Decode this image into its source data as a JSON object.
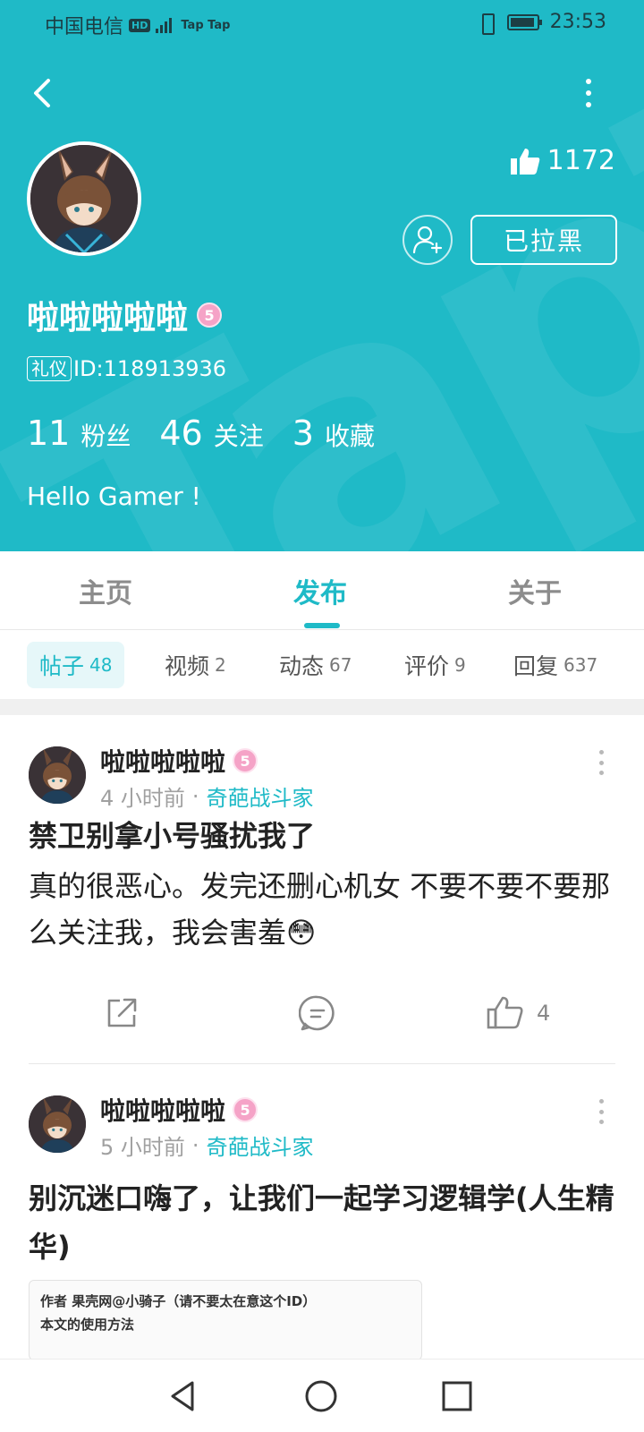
{
  "status_bar": {
    "carrier": "中国电信",
    "hd": "HD",
    "app_icons": "Tap Tap",
    "time": "23:53"
  },
  "profile": {
    "likes": "1172",
    "blocked_label": "已拉黑",
    "name": "啦啦啦啦啦",
    "level": "5",
    "tag": "礼仪",
    "id_text": "ID:118913936",
    "stats": [
      {
        "num": "11",
        "label": "粉丝"
      },
      {
        "num": "46",
        "label": "关注"
      },
      {
        "num": "3",
        "label": "收藏"
      }
    ],
    "bio": "Hello Gamer !"
  },
  "tabs": [
    {
      "label": "主页",
      "active": false
    },
    {
      "label": "发布",
      "active": true
    },
    {
      "label": "关于",
      "active": false
    }
  ],
  "sub_tabs": [
    {
      "label": "帖子",
      "count": "48",
      "active": true
    },
    {
      "label": "视频",
      "count": "2",
      "active": false
    },
    {
      "label": "动态",
      "count": "67",
      "active": false
    },
    {
      "label": "评价",
      "count": "9",
      "active": false
    },
    {
      "label": "回复",
      "count": "637",
      "active": false
    }
  ],
  "posts": [
    {
      "author": "啦啦啦啦啦",
      "level": "5",
      "time": "4 小时前",
      "dot": "·",
      "forum": "奇葩战斗家",
      "title": "禁卫别拿小号骚扰我了",
      "body": "真的很恶心。发完还删心机女 不要不要不要那么关注我，我会害羞😳",
      "likes": "4"
    },
    {
      "author": "啦啦啦啦啦",
      "level": "5",
      "time": "5 小时前",
      "dot": "·",
      "forum": "奇葩战斗家",
      "title": "别沉迷口嗨了，让我们一起学习逻辑学(人生精华)",
      "preview_line1": "作者 果壳网@小骑子（请不要太在意这个ID）",
      "preview_line2": "本文的使用方法"
    }
  ],
  "colors": {
    "brand": "#1fbac7",
    "level_badge": "#f5a3c7"
  }
}
